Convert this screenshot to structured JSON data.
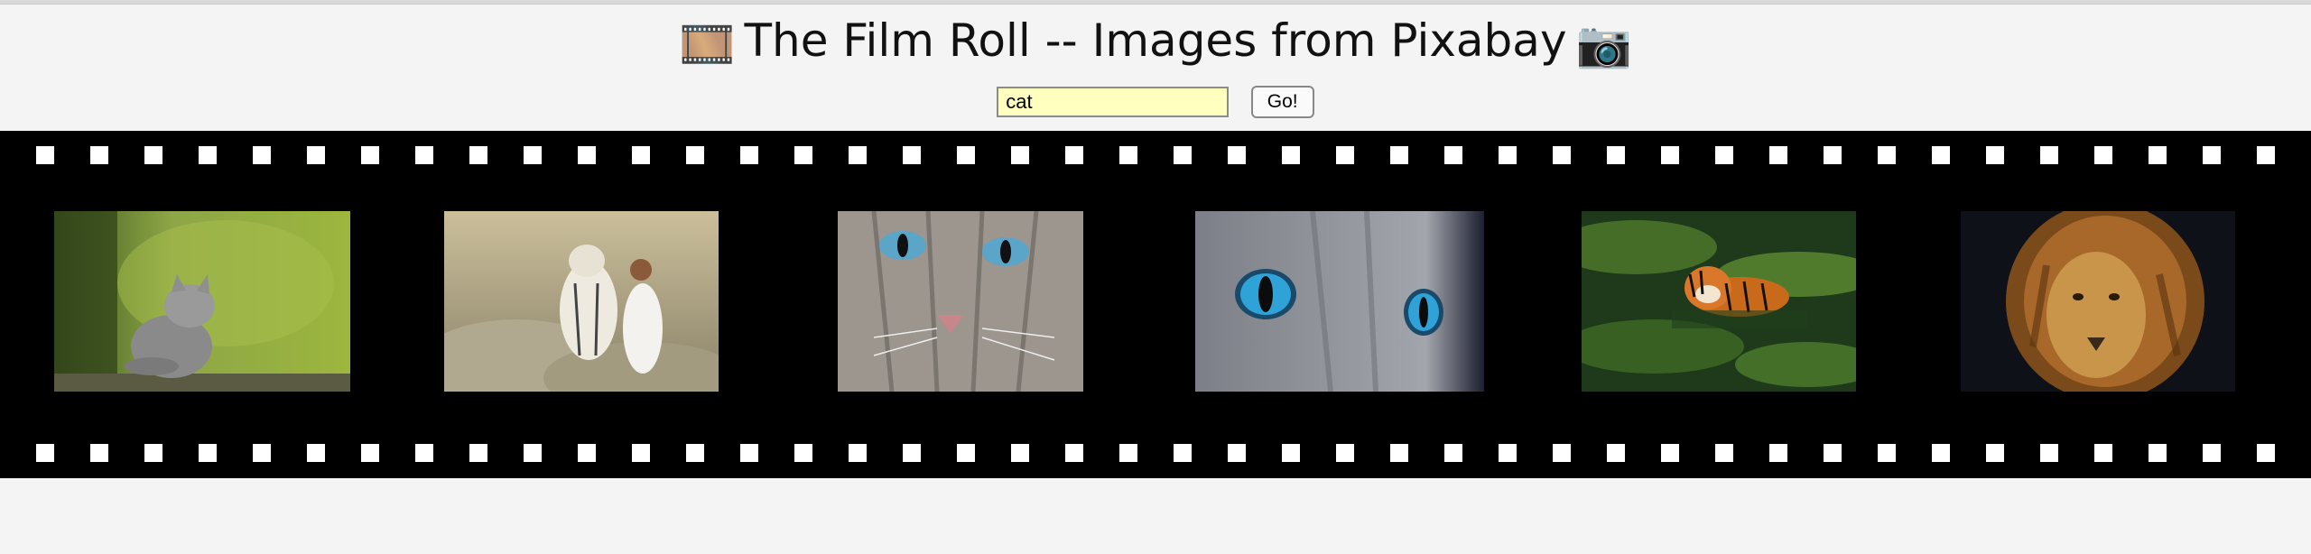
{
  "header": {
    "title": "The Film Roll -- Images from Pixabay",
    "left_emoji": "🎞️",
    "right_emoji": "📷",
    "left_icon": "film-frames-icon",
    "right_icon": "camera-icon"
  },
  "search": {
    "value": "cat",
    "button_label": "Go!"
  },
  "film_strip": {
    "sprocket_holes_per_row": 42,
    "frames": [
      {
        "subject": "grey kitten sitting on a mossy log looking up"
      },
      {
        "subject": "white tiger beside a woman in a white dress on a rock"
      },
      {
        "subject": "close-up of a tabby cat with blue eyes"
      },
      {
        "subject": "close-up of a grey cat with bright blue eyes"
      },
      {
        "subject": "tiger swimming in green water"
      },
      {
        "subject": "lion with golden mane on dark background"
      }
    ]
  },
  "colors": {
    "page_background": "#f4f4f4",
    "film_background": "#000000",
    "sprocket_hole": "#ffffff",
    "input_background": "#ffffc0"
  }
}
